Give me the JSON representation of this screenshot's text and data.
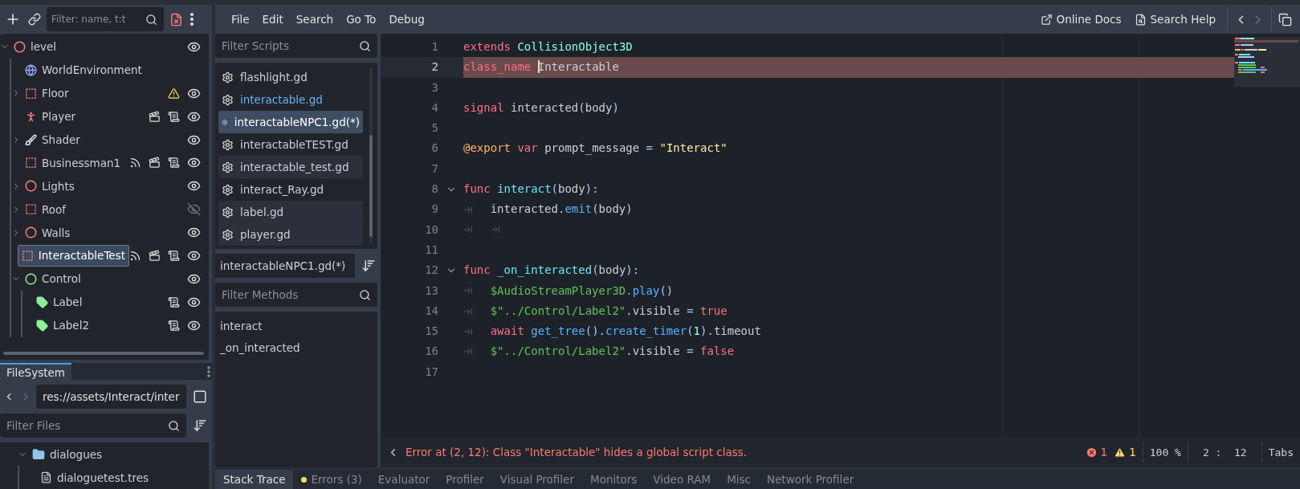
{
  "scene_dock": {
    "filter_placeholder": "Filter: name, t:t",
    "tree": [
      {
        "name": "level",
        "kind": "node3d",
        "expanded": true,
        "selected": false,
        "visible": true,
        "children": [
          {
            "name": "WorldEnvironment",
            "kind": "world",
            "selected": false
          },
          {
            "name": "Floor",
            "kind": "box",
            "expanded": false,
            "selected": false,
            "visible": true,
            "badges": [
              {
                "kind": "warning"
              }
            ]
          },
          {
            "name": "Player",
            "kind": "character",
            "selected": false,
            "visible": true,
            "badges": [
              {
                "kind": "scene"
              },
              {
                "kind": "script"
              }
            ]
          },
          {
            "name": "Shader",
            "kind": "shader",
            "expanded": false,
            "selected": false,
            "visible": true
          },
          {
            "name": "Businessman1",
            "kind": "box",
            "selected": false,
            "visible": true,
            "badges": [
              {
                "kind": "signal"
              },
              {
                "kind": "scene"
              },
              {
                "kind": "script"
              }
            ]
          },
          {
            "name": "Lights",
            "kind": "node3d",
            "expanded": false,
            "selected": false,
            "visible": true
          },
          {
            "name": "Roof",
            "kind": "box",
            "expanded": false,
            "selected": false,
            "visible": false
          },
          {
            "name": "Walls",
            "kind": "node3d",
            "expanded": false,
            "selected": false,
            "visible": true
          },
          {
            "name": "InteractableTest",
            "kind": "box",
            "selected": true,
            "visible": true,
            "badges": [
              {
                "kind": "signal"
              },
              {
                "kind": "scene"
              },
              {
                "kind": "script"
              }
            ]
          },
          {
            "name": "Control",
            "kind": "control",
            "expanded": true,
            "selected": false,
            "visible": true,
            "children": [
              {
                "name": "Label",
                "kind": "label",
                "selected": false,
                "visible": true,
                "badges": [
                  {
                    "kind": "script"
                  }
                ]
              },
              {
                "name": "Label2",
                "kind": "label",
                "selected": false,
                "visible": true,
                "badges": [
                  {
                    "kind": "script"
                  }
                ]
              }
            ]
          }
        ]
      }
    ]
  },
  "filesystem": {
    "tabs": [
      {
        "label": "FileSystem",
        "selected": true
      }
    ],
    "path": "res://assets/Interact/inter",
    "filter_placeholder": "Filter Files",
    "tree": [
      {
        "name": "dialogues",
        "kind": "folder",
        "expanded": true,
        "children": [
          {
            "name": "dialoguetest.tres",
            "kind": "file"
          }
        ]
      }
    ]
  },
  "menu": [
    "File",
    "Edit",
    "Search",
    "Go To",
    "Debug"
  ],
  "help_links": [
    {
      "label": "Online Docs",
      "kind": "docs"
    },
    {
      "label": "Search Help",
      "kind": "search"
    }
  ],
  "history": {
    "back_disabled": false,
    "forward_disabled": true
  },
  "scripts": {
    "filter_placeholder": "Filter Scripts",
    "items": [
      {
        "name": "flashlight.gd",
        "selected": false,
        "highlighted": false,
        "accent": false
      },
      {
        "name": "interactable.gd",
        "selected": false,
        "highlighted": false,
        "accent": true
      },
      {
        "name": "interactableNPC1.gd(*)",
        "selected": true,
        "highlighted": false,
        "accent": false
      },
      {
        "name": "interactableTEST.gd",
        "selected": false,
        "highlighted": false,
        "accent": false
      },
      {
        "name": "interactable_test.gd",
        "selected": false,
        "highlighted": true,
        "accent": false
      },
      {
        "name": "interact_Ray.gd",
        "selected": false,
        "highlighted": false,
        "accent": false
      },
      {
        "name": "label.gd",
        "selected": false,
        "highlighted": true,
        "accent": false
      },
      {
        "name": "player.gd",
        "selected": false,
        "highlighted": true,
        "accent": false
      }
    ],
    "current": "interactableNPC1.gd(*)",
    "methods_placeholder": "Filter Methods",
    "methods": [
      "interact",
      "_on_interacted"
    ]
  },
  "code": {
    "lines": [
      {
        "number": "1",
        "foldable": false,
        "error": false,
        "current": false,
        "tokens": [
          {
            "kind": "keyword",
            "text": "extends"
          },
          {
            "kind": "class",
            "text": " CollisionObject3D"
          }
        ]
      },
      {
        "number": "2",
        "foldable": false,
        "error": true,
        "current": true,
        "tokens": [
          {
            "kind": "keyword",
            "text": "class_name"
          },
          {
            "kind": "plain",
            "text": " Interactable",
            "caret": true
          }
        ]
      },
      {
        "number": "3",
        "foldable": false,
        "error": false,
        "current": false
      },
      {
        "number": "4",
        "foldable": false,
        "error": false,
        "current": false,
        "tokens": [
          {
            "kind": "keyword",
            "text": "signal"
          },
          {
            "kind": "plain",
            "text": " interacted"
          },
          {
            "kind": "symbol",
            "text": "("
          },
          {
            "kind": "plain",
            "text": "body"
          },
          {
            "kind": "symbol",
            "text": ")"
          }
        ]
      },
      {
        "number": "5",
        "foldable": false,
        "error": false,
        "current": false
      },
      {
        "number": "6",
        "foldable": false,
        "error": false,
        "current": false,
        "tokens": [
          {
            "kind": "annotation",
            "text": "@export"
          },
          {
            "kind": "keyword",
            "text": " var"
          },
          {
            "kind": "plain",
            "text": " prompt_message "
          },
          {
            "kind": "symbol",
            "text": "="
          },
          {
            "kind": "string",
            "text": " \"Interact\""
          }
        ]
      },
      {
        "number": "7",
        "foldable": false,
        "error": false,
        "current": false
      },
      {
        "number": "8",
        "foldable": true,
        "error": false,
        "current": false,
        "tokens": [
          {
            "kind": "keyword",
            "text": "func"
          },
          {
            "kind": "function",
            "text": " interact"
          },
          {
            "kind": "symbol",
            "text": "("
          },
          {
            "kind": "plain",
            "text": "body"
          },
          {
            "kind": "symbol",
            "text": "):"
          }
        ]
      },
      {
        "number": "9",
        "foldable": false,
        "error": false,
        "current": false,
        "tokens": [
          {
            "kind": "tab"
          },
          {
            "kind": "plain",
            "text": "interacted"
          },
          {
            "kind": "symbol",
            "text": "."
          },
          {
            "kind": "call",
            "text": "emit"
          },
          {
            "kind": "symbol",
            "text": "("
          },
          {
            "kind": "plain",
            "text": "body"
          },
          {
            "kind": "symbol",
            "text": ")"
          }
        ]
      },
      {
        "number": "10",
        "foldable": false,
        "error": false,
        "current": false,
        "tokens": [
          {
            "kind": "tab"
          },
          {
            "kind": "tab"
          }
        ]
      },
      {
        "number": "11",
        "foldable": false,
        "error": false,
        "current": false
      },
      {
        "number": "12",
        "foldable": true,
        "error": false,
        "current": false,
        "tokens": [
          {
            "kind": "keyword",
            "text": "func"
          },
          {
            "kind": "function",
            "text": " _on_interacted"
          },
          {
            "kind": "symbol",
            "text": "("
          },
          {
            "kind": "plain",
            "text": "body"
          },
          {
            "kind": "symbol",
            "text": "):"
          }
        ]
      },
      {
        "number": "13",
        "foldable": false,
        "error": false,
        "current": false,
        "tokens": [
          {
            "kind": "tab"
          },
          {
            "kind": "node_path",
            "text": "$AudioStreamPlayer3D"
          },
          {
            "kind": "call",
            "text": ".play"
          },
          {
            "kind": "symbol",
            "text": "()"
          }
        ]
      },
      {
        "number": "14",
        "foldable": false,
        "error": false,
        "current": false,
        "tokens": [
          {
            "kind": "tab"
          },
          {
            "kind": "node_path",
            "text": "$\"../Control/Label2\""
          },
          {
            "kind": "plain",
            "text": ".visible "
          },
          {
            "kind": "symbol",
            "text": "="
          },
          {
            "kind": "keyword",
            "text": " true"
          }
        ]
      },
      {
        "number": "15",
        "foldable": false,
        "error": false,
        "current": false,
        "tokens": [
          {
            "kind": "tab"
          },
          {
            "kind": "keyword",
            "text": "await"
          },
          {
            "kind": "call",
            "text": " get_tree"
          },
          {
            "kind": "symbol",
            "text": "()."
          },
          {
            "kind": "call",
            "text": "create_timer"
          },
          {
            "kind": "symbol",
            "text": "("
          },
          {
            "kind": "number",
            "text": "1"
          },
          {
            "kind": "symbol",
            "text": ")."
          },
          {
            "kind": "plain",
            "text": "timeout"
          }
        ]
      },
      {
        "number": "16",
        "foldable": false,
        "error": false,
        "current": false,
        "tokens": [
          {
            "kind": "tab"
          },
          {
            "kind": "node_path",
            "text": "$\"../Control/Label2\""
          },
          {
            "kind": "plain",
            "text": ".visible "
          },
          {
            "kind": "symbol",
            "text": "="
          },
          {
            "kind": "keyword",
            "text": " false"
          }
        ]
      },
      {
        "number": "17",
        "foldable": false,
        "error": false,
        "current": false
      }
    ]
  },
  "status_bar": {
    "message": "Error at (2, 12): Class \"Interactable\" hides a global script class.",
    "errors": "1",
    "warnings": "1",
    "zoom": "100 %",
    "position": "2 :  12",
    "indentation": "Tabs"
  },
  "bottom_tabs": [
    {
      "label": "Stack Trace",
      "selected": true,
      "alert": false
    },
    {
      "label": "Errors (3)",
      "selected": false,
      "alert": true
    },
    {
      "label": "Evaluator",
      "selected": false,
      "alert": false
    },
    {
      "label": "Profiler",
      "selected": false,
      "alert": false
    },
    {
      "label": "Visual Profiler",
      "selected": false,
      "alert": false
    },
    {
      "label": "Monitors",
      "selected": false,
      "alert": false
    },
    {
      "label": "Video RAM",
      "selected": false,
      "alert": false
    },
    {
      "label": "Misc",
      "selected": false,
      "alert": false
    },
    {
      "label": "Network Profiler",
      "selected": false,
      "alert": false
    }
  ]
}
